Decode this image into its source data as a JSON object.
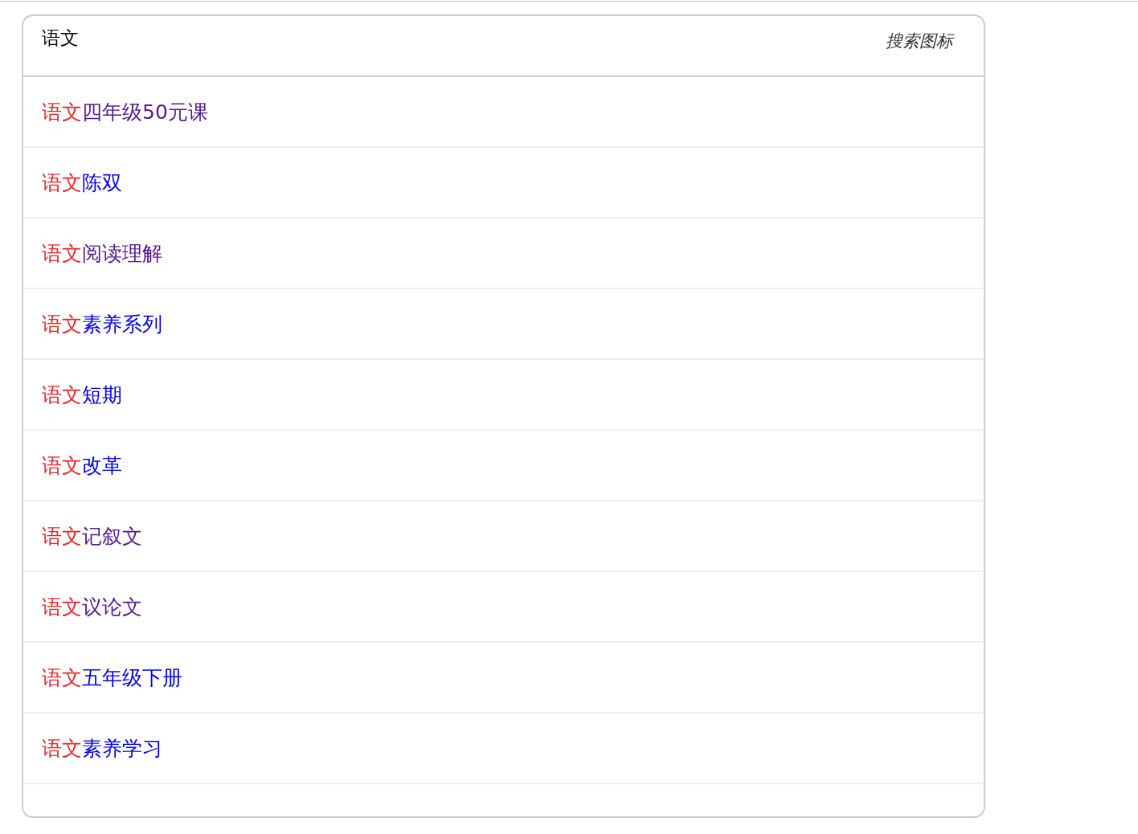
{
  "search": {
    "value": "语文",
    "icon_label": "搜索图标"
  },
  "suggestions": [
    {
      "match": "语文",
      "rest": "四年级50元课",
      "visited": true
    },
    {
      "match": "语文",
      "rest": "陈双",
      "visited": false
    },
    {
      "match": "语文",
      "rest": "阅读理解",
      "visited": true
    },
    {
      "match": "语文",
      "rest": "素养系列",
      "visited": false
    },
    {
      "match": "语文",
      "rest": "短期",
      "visited": false
    },
    {
      "match": "语文",
      "rest": "改革",
      "visited": false
    },
    {
      "match": "语文",
      "rest": "记叙文",
      "visited": true
    },
    {
      "match": "语文",
      "rest": "议论文",
      "visited": true
    },
    {
      "match": "语文",
      "rest": "五年级下册",
      "visited": false
    },
    {
      "match": "语文",
      "rest": "素养学习",
      "visited": false
    }
  ]
}
